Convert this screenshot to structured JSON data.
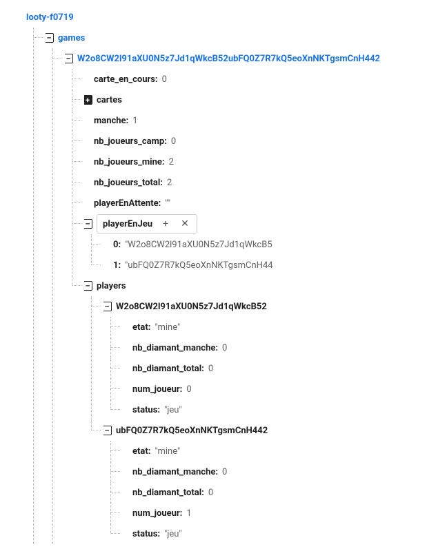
{
  "root": {
    "label": "looty-f0719"
  },
  "games": {
    "label": "games"
  },
  "gameId": {
    "label": "W2o8CW2l91aXU0N5z7Jd1qWkcB52ubFQ0Z7R7kQ5eoXnNKTgsmCnH442"
  },
  "carte_en_cours": {
    "key": "carte_en_cours:",
    "val": " 0"
  },
  "cartes": {
    "label": "cartes"
  },
  "manche": {
    "key": "manche:",
    "val": " 1"
  },
  "nb_joueurs_camp": {
    "key": "nb_joueurs_camp:",
    "val": " 0"
  },
  "nb_joueurs_mine": {
    "key": "nb_joueurs_mine:",
    "val": " 2"
  },
  "nb_joueurs_total": {
    "key": "nb_joueurs_total:",
    "val": " 2"
  },
  "playerEnAttente": {
    "key": "playerEnAttente:",
    "val": " \"\""
  },
  "playerEnJeu": {
    "label": "playerEnJeu",
    "items": [
      {
        "key": "0:",
        "val": " \"W2o8CW2l91aXU0N5z7Jd1qWkcB5"
      },
      {
        "key": "1:",
        "val": " \"ubFQ0Z7R7kQ5eoXnNKTgsmCnH44"
      }
    ]
  },
  "players": {
    "label": "players",
    "list": [
      {
        "id": "W2o8CW2l91aXU0N5z7Jd1qWkcB52",
        "etat": {
          "key": "etat:",
          "val": " \"mine\""
        },
        "nb_diamant_manche": {
          "key": "nb_diamant_manche:",
          "val": " 0"
        },
        "nb_diamant_total": {
          "key": "nb_diamant_total:",
          "val": " 0"
        },
        "num_joueur": {
          "key": "num_joueur:",
          "val": " 0"
        },
        "status": {
          "key": "status:",
          "val": " \"jeu\""
        }
      },
      {
        "id": "ubFQ0Z7R7kQ5eoXnNKTgsmCnH442",
        "etat": {
          "key": "etat:",
          "val": " \"mine\""
        },
        "nb_diamant_manche": {
          "key": "nb_diamant_manche:",
          "val": " 0"
        },
        "nb_diamant_total": {
          "key": "nb_diamant_total:",
          "val": " 0"
        },
        "num_joueur": {
          "key": "num_joueur:",
          "val": " 1"
        },
        "status": {
          "key": "status:",
          "val": " \"jeu\""
        }
      }
    ]
  }
}
